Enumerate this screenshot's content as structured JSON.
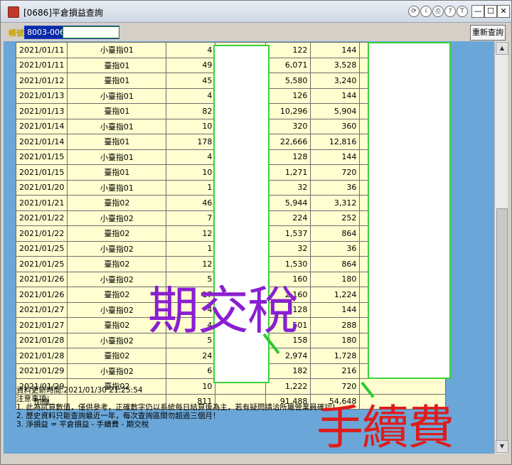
{
  "window": {
    "title": "[0686]平倉損益查詢",
    "title_buttons": [
      "⟳",
      "i",
      "⎙",
      "?",
      "T"
    ],
    "controls": [
      "—",
      "☐",
      "✕"
    ]
  },
  "toolbar": {
    "account_label": "帳號",
    "account_value": "8003-0066",
    "refresh_label": "重新查詢"
  },
  "table": {
    "rows": [
      {
        "date": "2021/01/11",
        "product": "小臺指01",
        "qty": "4",
        "a": "122",
        "b": "144"
      },
      {
        "date": "2021/01/11",
        "product": "臺指01",
        "qty": "49",
        "a": "6,071",
        "b": "3,528"
      },
      {
        "date": "2021/01/12",
        "product": "臺指01",
        "qty": "45",
        "a": "5,580",
        "b": "3,240"
      },
      {
        "date": "2021/01/13",
        "product": "小臺指01",
        "qty": "4",
        "a": "126",
        "b": "144"
      },
      {
        "date": "2021/01/13",
        "product": "臺指01",
        "qty": "82",
        "a": "10,296",
        "b": "5,904"
      },
      {
        "date": "2021/01/14",
        "product": "小臺指01",
        "qty": "10",
        "a": "320",
        "b": "360"
      },
      {
        "date": "2021/01/14",
        "product": "臺指01",
        "qty": "178",
        "a": "22,666",
        "b": "12,816"
      },
      {
        "date": "2021/01/15",
        "product": "小臺指01",
        "qty": "4",
        "a": "128",
        "b": "144"
      },
      {
        "date": "2021/01/15",
        "product": "臺指01",
        "qty": "10",
        "a": "1,271",
        "b": "720"
      },
      {
        "date": "2021/01/20",
        "product": "小臺指01",
        "qty": "1",
        "a": "32",
        "b": "36"
      },
      {
        "date": "2021/01/21",
        "product": "臺指02",
        "qty": "46",
        "a": "5,944",
        "b": "3,312"
      },
      {
        "date": "2021/01/22",
        "product": "小臺指02",
        "qty": "7",
        "a": "224",
        "b": "252"
      },
      {
        "date": "2021/01/22",
        "product": "臺指02",
        "qty": "12",
        "a": "1,537",
        "b": "864"
      },
      {
        "date": "2021/01/25",
        "product": "小臺指02",
        "qty": "1",
        "a": "32",
        "b": "36"
      },
      {
        "date": "2021/01/25",
        "product": "臺指02",
        "qty": "12",
        "a": "1,530",
        "b": "864"
      },
      {
        "date": "2021/01/26",
        "product": "小臺指02",
        "qty": "5",
        "a": "160",
        "b": "180"
      },
      {
        "date": "2021/01/26",
        "product": "臺指02",
        "qty": "17",
        "a": "2,160",
        "b": "1,224"
      },
      {
        "date": "2021/01/27",
        "product": "小臺指02",
        "qty": "4",
        "a": "128",
        "b": "144"
      },
      {
        "date": "2021/01/27",
        "product": "臺指02",
        "qty": "4",
        "a": "501",
        "b": "288"
      },
      {
        "date": "2021/01/28",
        "product": "小臺指02",
        "qty": "5",
        "a": "158",
        "b": "180"
      },
      {
        "date": "2021/01/28",
        "product": "臺指02",
        "qty": "24",
        "a": "2,974",
        "b": "1,728"
      },
      {
        "date": "2021/01/29",
        "product": "小臺指02",
        "qty": "6",
        "a": "182",
        "b": "216"
      },
      {
        "date": "2021/01/29",
        "product": "臺指02",
        "qty": "10",
        "a": "1,222",
        "b": "720"
      }
    ],
    "total": {
      "label": "加總",
      "qty": "811",
      "a": "91,488",
      "b": "54,648"
    }
  },
  "notes": {
    "updated": "資料更新時間:2021/01/30 21:25:54",
    "heading": " 注意事項：",
    "line1": "1. 此為試算數值，僅供參考，正確數字仍以系統每日結算後為主，若有疑問請洽所屬營業員確認！",
    "line2": "2. 歷史資料只能查詢最近一年，每次查詢區間勿超過三個月！",
    "line3": "3. 淨損益 = 平倉損益 - 手續費 - 期交稅"
  },
  "annotations": {
    "tax": "期交稅",
    "fee": "手續費",
    "tax_color": "#8a1fd2",
    "fee_color": "#e01b1b",
    "mask_border_color": "#3ad13a"
  }
}
